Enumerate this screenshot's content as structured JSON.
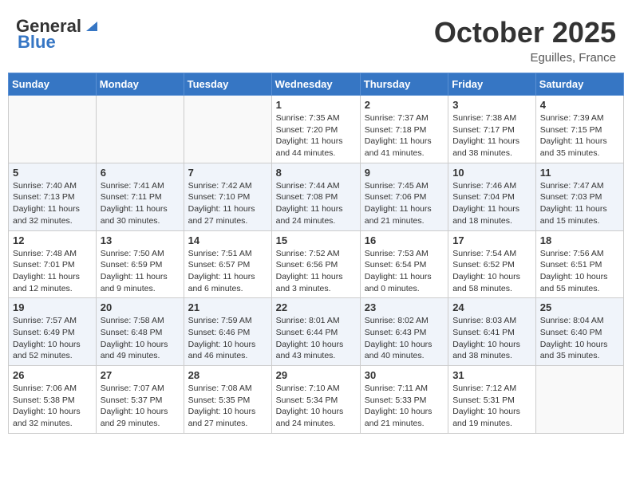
{
  "header": {
    "logo_general": "General",
    "logo_blue": "Blue",
    "month": "October 2025",
    "location": "Eguilles, France"
  },
  "weekdays": [
    "Sunday",
    "Monday",
    "Tuesday",
    "Wednesday",
    "Thursday",
    "Friday",
    "Saturday"
  ],
  "weeks": [
    [
      {
        "day": "",
        "info": ""
      },
      {
        "day": "",
        "info": ""
      },
      {
        "day": "",
        "info": ""
      },
      {
        "day": "1",
        "info": "Sunrise: 7:35 AM\nSunset: 7:20 PM\nDaylight: 11 hours and 44 minutes."
      },
      {
        "day": "2",
        "info": "Sunrise: 7:37 AM\nSunset: 7:18 PM\nDaylight: 11 hours and 41 minutes."
      },
      {
        "day": "3",
        "info": "Sunrise: 7:38 AM\nSunset: 7:17 PM\nDaylight: 11 hours and 38 minutes."
      },
      {
        "day": "4",
        "info": "Sunrise: 7:39 AM\nSunset: 7:15 PM\nDaylight: 11 hours and 35 minutes."
      }
    ],
    [
      {
        "day": "5",
        "info": "Sunrise: 7:40 AM\nSunset: 7:13 PM\nDaylight: 11 hours and 32 minutes."
      },
      {
        "day": "6",
        "info": "Sunrise: 7:41 AM\nSunset: 7:11 PM\nDaylight: 11 hours and 30 minutes."
      },
      {
        "day": "7",
        "info": "Sunrise: 7:42 AM\nSunset: 7:10 PM\nDaylight: 11 hours and 27 minutes."
      },
      {
        "day": "8",
        "info": "Sunrise: 7:44 AM\nSunset: 7:08 PM\nDaylight: 11 hours and 24 minutes."
      },
      {
        "day": "9",
        "info": "Sunrise: 7:45 AM\nSunset: 7:06 PM\nDaylight: 11 hours and 21 minutes."
      },
      {
        "day": "10",
        "info": "Sunrise: 7:46 AM\nSunset: 7:04 PM\nDaylight: 11 hours and 18 minutes."
      },
      {
        "day": "11",
        "info": "Sunrise: 7:47 AM\nSunset: 7:03 PM\nDaylight: 11 hours and 15 minutes."
      }
    ],
    [
      {
        "day": "12",
        "info": "Sunrise: 7:48 AM\nSunset: 7:01 PM\nDaylight: 11 hours and 12 minutes."
      },
      {
        "day": "13",
        "info": "Sunrise: 7:50 AM\nSunset: 6:59 PM\nDaylight: 11 hours and 9 minutes."
      },
      {
        "day": "14",
        "info": "Sunrise: 7:51 AM\nSunset: 6:57 PM\nDaylight: 11 hours and 6 minutes."
      },
      {
        "day": "15",
        "info": "Sunrise: 7:52 AM\nSunset: 6:56 PM\nDaylight: 11 hours and 3 minutes."
      },
      {
        "day": "16",
        "info": "Sunrise: 7:53 AM\nSunset: 6:54 PM\nDaylight: 11 hours and 0 minutes."
      },
      {
        "day": "17",
        "info": "Sunrise: 7:54 AM\nSunset: 6:52 PM\nDaylight: 10 hours and 58 minutes."
      },
      {
        "day": "18",
        "info": "Sunrise: 7:56 AM\nSunset: 6:51 PM\nDaylight: 10 hours and 55 minutes."
      }
    ],
    [
      {
        "day": "19",
        "info": "Sunrise: 7:57 AM\nSunset: 6:49 PM\nDaylight: 10 hours and 52 minutes."
      },
      {
        "day": "20",
        "info": "Sunrise: 7:58 AM\nSunset: 6:48 PM\nDaylight: 10 hours and 49 minutes."
      },
      {
        "day": "21",
        "info": "Sunrise: 7:59 AM\nSunset: 6:46 PM\nDaylight: 10 hours and 46 minutes."
      },
      {
        "day": "22",
        "info": "Sunrise: 8:01 AM\nSunset: 6:44 PM\nDaylight: 10 hours and 43 minutes."
      },
      {
        "day": "23",
        "info": "Sunrise: 8:02 AM\nSunset: 6:43 PM\nDaylight: 10 hours and 40 minutes."
      },
      {
        "day": "24",
        "info": "Sunrise: 8:03 AM\nSunset: 6:41 PM\nDaylight: 10 hours and 38 minutes."
      },
      {
        "day": "25",
        "info": "Sunrise: 8:04 AM\nSunset: 6:40 PM\nDaylight: 10 hours and 35 minutes."
      }
    ],
    [
      {
        "day": "26",
        "info": "Sunrise: 7:06 AM\nSunset: 5:38 PM\nDaylight: 10 hours and 32 minutes."
      },
      {
        "day": "27",
        "info": "Sunrise: 7:07 AM\nSunset: 5:37 PM\nDaylight: 10 hours and 29 minutes."
      },
      {
        "day": "28",
        "info": "Sunrise: 7:08 AM\nSunset: 5:35 PM\nDaylight: 10 hours and 27 minutes."
      },
      {
        "day": "29",
        "info": "Sunrise: 7:10 AM\nSunset: 5:34 PM\nDaylight: 10 hours and 24 minutes."
      },
      {
        "day": "30",
        "info": "Sunrise: 7:11 AM\nSunset: 5:33 PM\nDaylight: 10 hours and 21 minutes."
      },
      {
        "day": "31",
        "info": "Sunrise: 7:12 AM\nSunset: 5:31 PM\nDaylight: 10 hours and 19 minutes."
      },
      {
        "day": "",
        "info": ""
      }
    ]
  ]
}
